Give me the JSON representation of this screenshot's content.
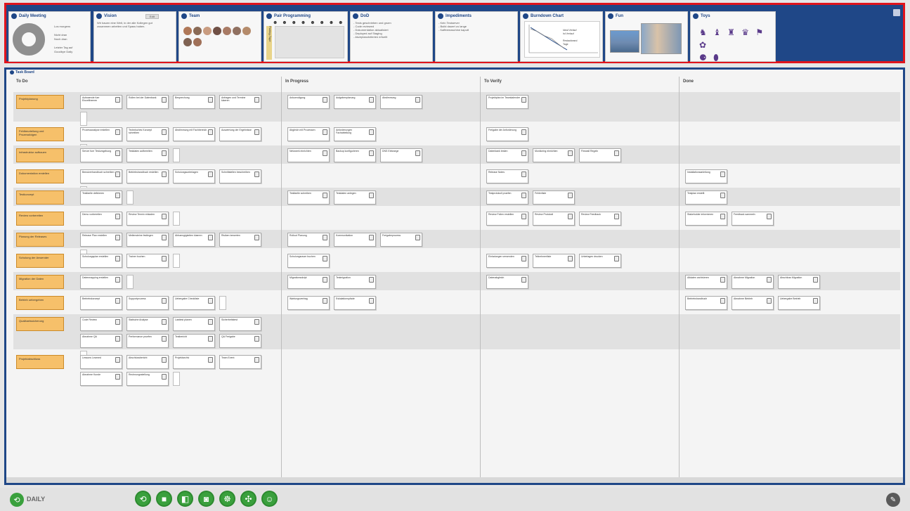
{
  "widgets": {
    "daily": {
      "title": "Daily Meeting",
      "text": "Los morgens\n\nNicht dran\nNoch dran\n\nLetzter Tag auf\nGoodbye Daily"
    },
    "vision": {
      "title": "Vision",
      "button": "Edit",
      "text": "Wir bauen eine Welt, in der alle Kollegen gut\nzusammen arbeiten und Spass haben."
    },
    "team": {
      "title": "Team"
    },
    "pair": {
      "title": "Pair Programming",
      "tape": "Pairing-Tape",
      "icons": "☻ ☻ ☻ ☻ ☻ ☻ ☻ ☻"
    },
    "dod": {
      "title": "DoD",
      "text": "- Tests geschrieben und gruen\n- Code reviewed\n- Dokumentation aktualisiert\n- Deployed auf Staging\n- Akzeptanzkriterien erfuellt"
    },
    "impediments": {
      "title": "Impediments",
      "text": "- Kein Testserver\n- Build dauert zu lange\n- Kaffeemaschine kaputt"
    },
    "burndown": {
      "title": "Burndown Chart",
      "legend": "Ideal Verlauf\nIst Verlauf\n\nRestaufwand\nTage"
    },
    "fun": {
      "title": "Fun"
    },
    "toys": {
      "title": "Toys",
      "items": "♞ ♝ ♜ ♛ ⚑ ✿\n⚈ ⬮"
    }
  },
  "board": {
    "title": "Task Board",
    "columns": [
      "To Do",
      "In Progress",
      "To Verify",
      "Done"
    ]
  },
  "rows": [
    {
      "story": "Projektplanung",
      "tasks": [
        [
          "Aufwaende fuer Einzelthemen",
          "Rollen bei der Datenbank",
          "Besprechung",
          "Anfragen und Termine klaeren"
        ],
        [
          "Ankuendigung",
          "Aufgabenplanung",
          "Abstimmung"
        ],
        [
          "Projektplan im Teamkalender"
        ],
        []
      ]
    },
    {
      "story": "Fehlbeurteilung und Prozessfolgen",
      "tasks": [
        [
          "Prozessanalyse erstellen",
          "Technisches Konzept schreiben",
          "Abstimmung mit Fachbereich",
          "Auswertung der Ergebnisse"
        ],
        [
          "Abgleich mit Prozessen",
          "Anforderungen Fachabteilung"
        ],
        [
          "Freigabe der Anforderung"
        ],
        []
      ]
    },
    {
      "story": "Infrastruktur aufbauen",
      "tasks": [
        [
          "Server fuer Testumgebung",
          "Testdaten aufbereiten"
        ],
        [
          "Netzwerk einrichten",
          "Backup konfigurieren",
          "DNS Eintraege"
        ],
        [
          "Datenbank testen",
          "Monitoring einrichten",
          "Firewall Regeln"
        ],
        []
      ]
    },
    {
      "story": "Dokumentation erstellen",
      "tasks": [
        [
          "Benutzerhandbuch schreiben",
          "Betriebshandbuch erstellen",
          "Schulungsunterlagen",
          "Schnittstellen beschreiben"
        ],
        [],
        [
          "Release Notes"
        ],
        [
          "Installationsanleitung"
        ]
      ]
    },
    {
      "story": "Testkonzept",
      "tasks": [
        [
          "Testfaelle definieren"
        ],
        [
          "Testfaelle schreiben",
          "Testdaten anlegen"
        ],
        [
          "Testprotokoll pruefen",
          "Fehlerliste"
        ],
        [
          "Testplan erstellt"
        ]
      ]
    },
    {
      "story": "Review vorbereiten",
      "tasks": [
        [
          "Demo vorbereiten",
          "Review Termin einladen"
        ],
        [],
        [
          "Review Folien erstellen",
          "Review Protokoll",
          "Review Feedback"
        ],
        [
          "Stakeholder informieren",
          "Feedback sammeln"
        ]
      ]
    },
    {
      "story": "Planung der Releases",
      "tasks": [
        [
          "Release Plan erstellen",
          "Meilensteine festlegen",
          "Abhaengigkeiten klaeren",
          "Risiken bewerten"
        ],
        [
          "Rollout Planung",
          "Kommunikation",
          "Freigabeprozess"
        ],
        [],
        []
      ]
    },
    {
      "story": "Schulung der Anwender",
      "tasks": [
        [
          "Schulungsplan erstellen",
          "Trainer buchen"
        ],
        [
          "Schulungsraum buchen"
        ],
        [
          "Einladungen versenden",
          "Teilnehmerliste",
          "Unterlagen drucken"
        ],
        []
      ]
    },
    {
      "story": "Migration der Daten",
      "tasks": [
        [
          "Datenmapping erstellen"
        ],
        [
          "Migrationsskript",
          "Testmigration"
        ],
        [
          "Datenabgleich"
        ],
        [
          "Altdaten archivieren",
          "Abnahme Migration",
          "Abschluss Migration"
        ]
      ]
    },
    {
      "story": "Betrieb uebergeben",
      "tasks": [
        [
          "Betriebskonzept",
          "Supportprozess",
          "Uebergabe Checkliste"
        ],
        [
          "Wartungsvertrag",
          "Eskalationspfade"
        ],
        [],
        [
          "Betriebshandbuch",
          "Abnahme Betrieb",
          "Uebergabe Betrieb"
        ]
      ]
    },
    {
      "story": "Qualitaetssicherung",
      "tasks": [
        [
          "Code Review",
          "Statische Analyse",
          "Lasttest planen",
          "Sicherheitstest",
          "Abnahme QA",
          "Performance pruefen",
          "Testbericht",
          "QA Freigabe"
        ],
        [],
        [],
        []
      ]
    },
    {
      "story": "Projektabschluss",
      "tasks": [
        [
          "Lessons Learned",
          "Abschlussbericht",
          "Projektarchiv",
          "Team Event",
          "Abnahme Kunde",
          "Rechnungsstellung"
        ],
        [],
        [],
        []
      ]
    }
  ],
  "bottom": {
    "app_name": "DAILY",
    "buttons": [
      "refresh-icon",
      "chat-icon",
      "notes-icon",
      "message-icon",
      "share-icon",
      "tools-icon",
      "emoji-icon"
    ],
    "button_glyphs": [
      "⟲",
      "■",
      "◧",
      "◙",
      "☸",
      "✣",
      "☺"
    ],
    "settings_glyph": "✎"
  },
  "colors": {
    "accent": "#1f4787",
    "highlight": "#e0141c",
    "story": "#f6c06a",
    "action": "#3aa03d"
  }
}
